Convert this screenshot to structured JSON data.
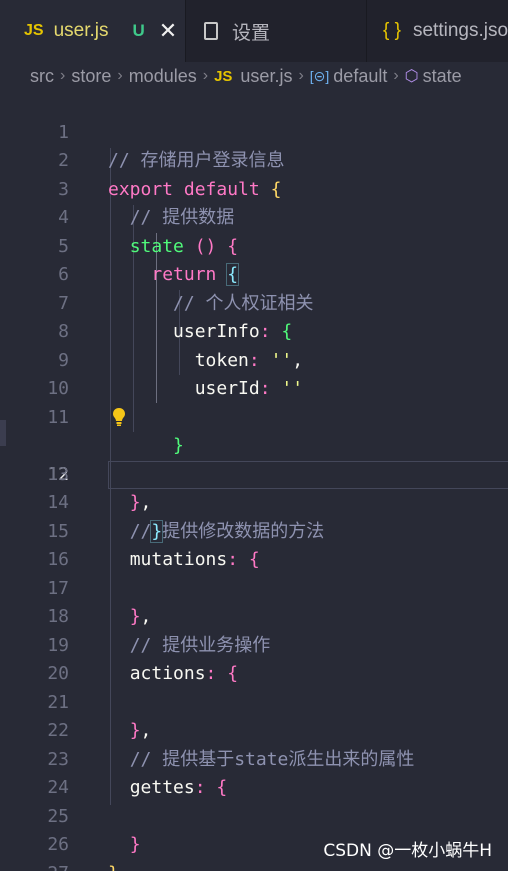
{
  "tabs": [
    {
      "icon": "JS",
      "label": "user.js",
      "status": "U",
      "close": "✕"
    },
    {
      "label": "设置"
    },
    {
      "icon": "{ }",
      "label": "settings.json"
    }
  ],
  "breadcrumb": {
    "items": [
      "src",
      "store",
      "modules",
      "user.js",
      "default",
      "state"
    ],
    "js_icon": "JS"
  },
  "editor": {
    "current_line": 12,
    "lines": [
      {
        "n": "1"
      },
      {
        "n": "2"
      },
      {
        "n": "3"
      },
      {
        "n": "4"
      },
      {
        "n": "5"
      },
      {
        "n": "6"
      },
      {
        "n": "7"
      },
      {
        "n": "8"
      },
      {
        "n": "9"
      },
      {
        "n": "10"
      },
      {
        "n": "11"
      },
      {
        "n": "12"
      },
      {
        "n": "13"
      },
      {
        "n": "14"
      },
      {
        "n": "15"
      },
      {
        "n": "16"
      },
      {
        "n": "17"
      },
      {
        "n": "18"
      },
      {
        "n": "19"
      },
      {
        "n": "20"
      },
      {
        "n": "21"
      },
      {
        "n": "22"
      },
      {
        "n": "23"
      },
      {
        "n": "24"
      },
      {
        "n": "25"
      },
      {
        "n": "26"
      },
      {
        "n": "27"
      }
    ],
    "tokens": {
      "c1": "// 存储用户登录信息",
      "export": "export",
      "default": "default",
      "c3": "// 提供数据",
      "state": "state",
      "parens": "()",
      "return": "return",
      "c6": "// 个人权证相关",
      "userInfo": "userInfo",
      "token": "token",
      "userId": "userId",
      "empty_str": "''",
      "c14": "// 提供修改数据的方法",
      "mutations": "mutations",
      "c18": "// 提供业务操作",
      "actions": "actions",
      "c22": "// 提供基于state派生出来的属性",
      "gettes": "gettes"
    }
  },
  "watermark": "CSDN @一枚小蜗牛H",
  "colors": {
    "keyword": "#ff79c6",
    "function": "#50fa7b",
    "string": "#f1fa8c",
    "comment": "#8e92b0",
    "background": "#282a36"
  }
}
